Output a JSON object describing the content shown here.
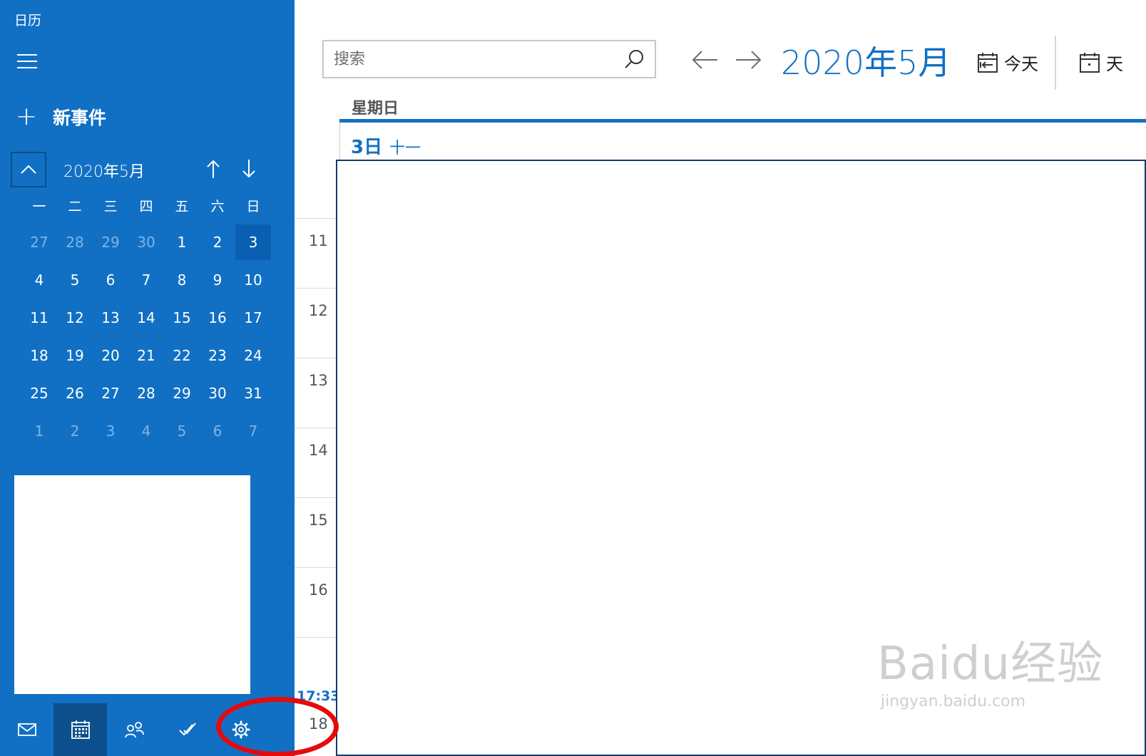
{
  "app": {
    "title": "日历"
  },
  "sidebar": {
    "new_event_label": "新事件",
    "mini_calendar": {
      "month_label": "2020年5月",
      "weekdays": [
        "一",
        "二",
        "三",
        "四",
        "五",
        "六",
        "日"
      ],
      "weeks": [
        [
          {
            "d": "27",
            "m": true
          },
          {
            "d": "28",
            "m": true
          },
          {
            "d": "29",
            "m": true
          },
          {
            "d": "30",
            "m": true
          },
          {
            "d": "1"
          },
          {
            "d": "2"
          },
          {
            "d": "3",
            "sel": true
          }
        ],
        [
          {
            "d": "4"
          },
          {
            "d": "5"
          },
          {
            "d": "6"
          },
          {
            "d": "7"
          },
          {
            "d": "8"
          },
          {
            "d": "9"
          },
          {
            "d": "10"
          }
        ],
        [
          {
            "d": "11"
          },
          {
            "d": "12"
          },
          {
            "d": "13"
          },
          {
            "d": "14"
          },
          {
            "d": "15"
          },
          {
            "d": "16"
          },
          {
            "d": "17"
          }
        ],
        [
          {
            "d": "18"
          },
          {
            "d": "19"
          },
          {
            "d": "20"
          },
          {
            "d": "21"
          },
          {
            "d": "22"
          },
          {
            "d": "23"
          },
          {
            "d": "24"
          }
        ],
        [
          {
            "d": "25"
          },
          {
            "d": "26"
          },
          {
            "d": "27"
          },
          {
            "d": "28"
          },
          {
            "d": "29"
          },
          {
            "d": "30"
          },
          {
            "d": "31"
          }
        ],
        [
          {
            "d": "1",
            "m": true
          },
          {
            "d": "2",
            "m": true
          },
          {
            "d": "3",
            "m": true
          },
          {
            "d": "4",
            "m": true
          },
          {
            "d": "5",
            "m": true
          },
          {
            "d": "6",
            "m": true
          },
          {
            "d": "7",
            "m": true
          }
        ]
      ]
    },
    "bottom_nav": [
      {
        "name": "mail-icon",
        "active": false
      },
      {
        "name": "calendar-icon",
        "active": true
      },
      {
        "name": "people-icon",
        "active": false
      },
      {
        "name": "todo-icon",
        "active": false
      },
      {
        "name": "settings-icon",
        "active": false
      }
    ]
  },
  "toolbar": {
    "search_placeholder": "搜索",
    "month_title": "2020年5月",
    "today_label": "今天",
    "day_view_label": "天"
  },
  "day_view": {
    "weekday": "星期日",
    "date_label": "3日",
    "lunar_label": "十一",
    "hours": [
      "11",
      "12",
      "13",
      "14",
      "15",
      "16"
    ],
    "now_time": "17:33",
    "next_hour_partial": "18"
  },
  "watermark": {
    "brand": "Baidu经验",
    "url": "jingyan.baidu.com"
  },
  "colors": {
    "accent": "#1170c4",
    "highlight_ring": "#e50b0b"
  }
}
